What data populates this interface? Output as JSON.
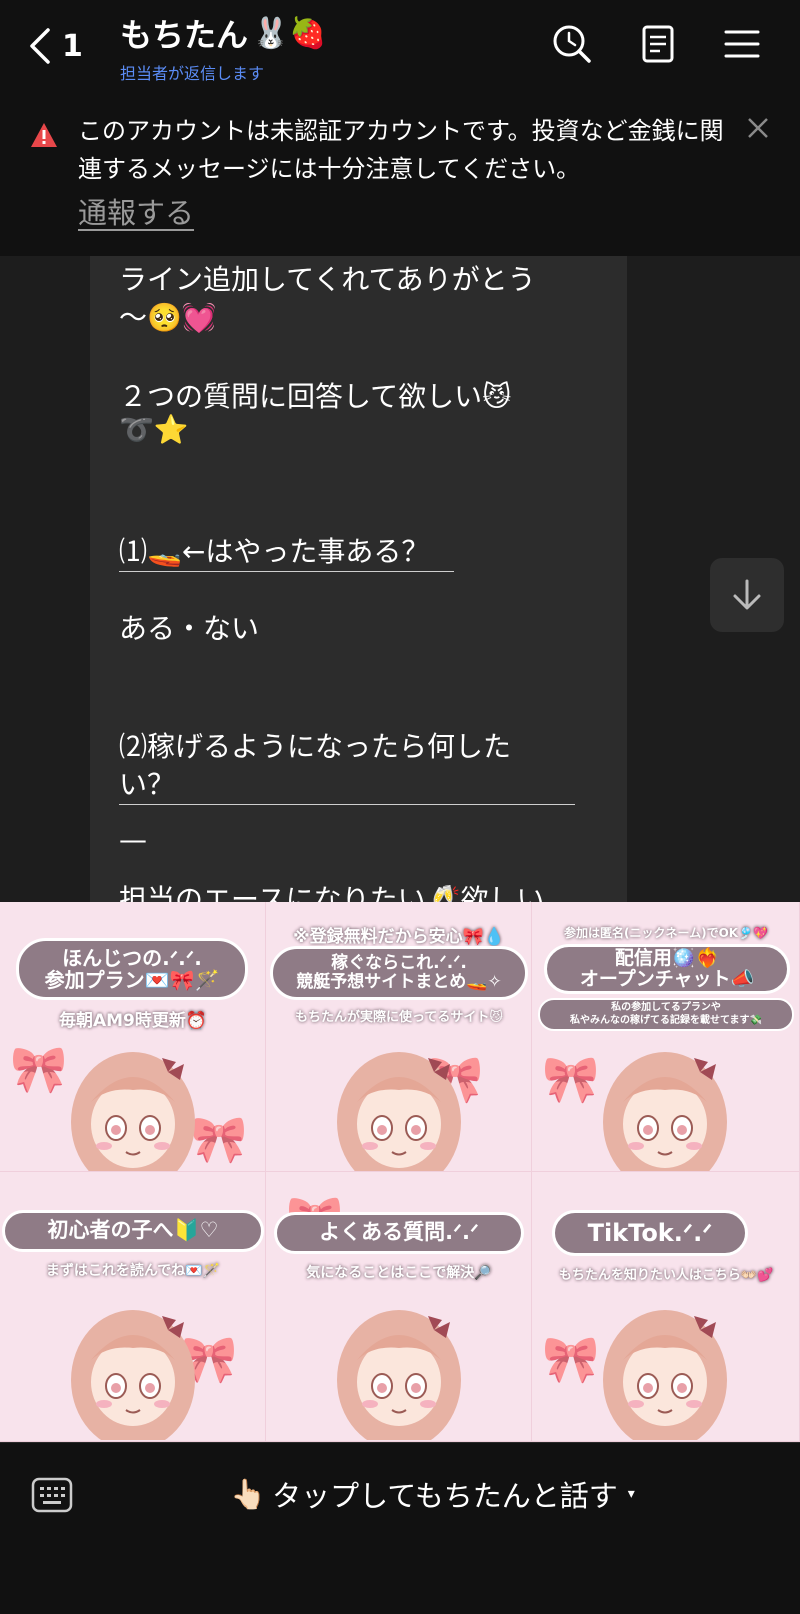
{
  "header": {
    "back_count": "1",
    "title": "もちたん",
    "title_emoji": "🐰🍓",
    "subtitle": "担当者が返信します"
  },
  "banner": {
    "warning_text": "このアカウントは未認証アカウントです。投資など金銭に関連するメッセージには十分注意してください。",
    "report_label": "通報する"
  },
  "chat": {
    "lines": [
      "ライン追加してくれてありがとう",
      "〜🥺💓",
      "２つの質問に回答して欲しい😼",
      "➰⭐",
      "⑴🚤←はやった事ある？",
      "ある・ない",
      "⑵稼げるようになったら何した",
      "い？",
      "—",
      "担当のエースになりたい🥂欲しい"
    ]
  },
  "rich_menu": {
    "items": [
      {
        "top": "",
        "pill": "ほんじつの.ᐟ.ᐟ.\n参加プラン💌🎀🪄",
        "caption": "毎朝AM9時更新⏰"
      },
      {
        "top": "※登録無料だから安心🎀💧",
        "pill": "稼ぐならこれ.ᐟ.ᐟ.\n競艇予想サイトまとめ🚤✧",
        "caption": "もちたんが実際に使ってるサイト😼"
      },
      {
        "top": "参加は匿名(ニックネーム)でOK🎐💖",
        "pill": "配信用🪩❤️‍🔥\nオープンチャット📣",
        "caption": "私の参加してるプランや\n私やみんなの稼げてる記録を載せてます💸"
      },
      {
        "top": "",
        "pill": "初心者の子へ🔰♡",
        "caption": "まずはこれを読んでね💌🪄"
      },
      {
        "top": "",
        "pill": "よくある質問.ᐟ.ᐟ",
        "caption": "気になることはここで解決🔎"
      },
      {
        "top": "",
        "pill": "TikTok.ᐟ.ᐟ",
        "caption": "もちたんを知りたい人はこちら👐🏻💕"
      }
    ]
  },
  "bottom": {
    "tap_emoji": "👆🏻",
    "tap_label": "タップしてもちたんと話す",
    "caret": "▾"
  },
  "colors": {
    "accent_link": "#5b8cf5",
    "warning_red": "#e8474a",
    "pill_bg": "#8f7b86",
    "menu_bg": "#f8e3ec"
  }
}
